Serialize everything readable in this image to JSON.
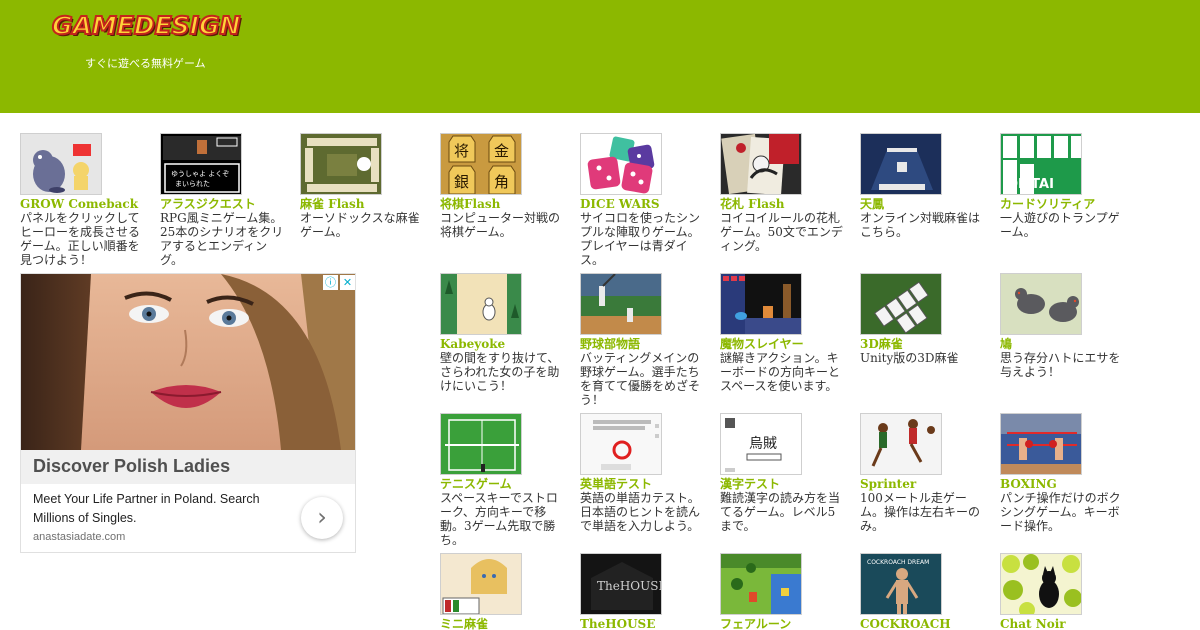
{
  "header": {
    "logo": "GAMEDESIGN",
    "tagline": "すぐに遊べる無料ゲーム",
    "bg_color": "#8cb800"
  },
  "games": [
    {
      "title": "GROW Comeback",
      "desc": "パネルをクリックしてヒーローを成長させるゲーム。正しい順番を見つけよう！",
      "thumb": "grow"
    },
    {
      "title": "アラスジクエスト",
      "desc": "RPG風ミニゲーム集。25本のシナリオをクリアするとエンディング。",
      "thumb": "rpg"
    },
    {
      "title": "麻雀 Flash",
      "desc": "オーソドックスな麻雀ゲーム。",
      "thumb": "mahjong"
    },
    {
      "title": "将棋Flash",
      "desc": "コンピューター対戦の将棋ゲーム。",
      "thumb": "shogi"
    },
    {
      "title": "DICE WARS",
      "desc": "サイコロを使ったシンプルな陣取りゲーム。プレイヤーは青ダイス。",
      "thumb": "dice"
    },
    {
      "title": "花札 Flash",
      "desc": "コイコイルールの花札ゲーム。50文でエンディング。",
      "thumb": "hanafuda"
    },
    {
      "title": "天鳳",
      "desc": "オンライン対戦麻雀はこちら。",
      "thumb": "tenhou"
    },
    {
      "title": "カードソリティア",
      "desc": "一人遊びのトランプゲーム。",
      "thumb": "solitaire"
    },
    {
      "title": "Kabeyoke",
      "desc": "壁の間をすり抜けて、さらわれた女の子を助けにいこう！",
      "thumb": "kabeyoke"
    },
    {
      "title": "野球部物語",
      "desc": "バッティングメインの野球ゲーム。選手たちを育てて優勝をめざそう！",
      "thumb": "baseball"
    },
    {
      "title": "魔物スレイヤー",
      "desc": "謎解きアクション。キーボードの方向キーとスペースを使います。",
      "thumb": "slayer"
    },
    {
      "title": "3D麻雀",
      "desc": "Unity版の3D麻雀",
      "thumb": "mahjong3d"
    },
    {
      "title": "鳩",
      "desc": "思う存分ハトにエサを与えよう！",
      "thumb": "pigeon"
    },
    {
      "title": "テニスゲーム",
      "desc": "スペースキーでストローク、方向キーで移動。3ゲーム先取で勝ち。",
      "thumb": "tennis"
    },
    {
      "title": "英単語テスト",
      "desc": "英語の単語カテスト。日本語のヒントを読んで単語を入力しよう。",
      "thumb": "eitango"
    },
    {
      "title": "漢字テスト",
      "desc": "難読漢字の読み方を当てるゲーム。レベル5まで。",
      "thumb": "kanji"
    },
    {
      "title": "Sprinter",
      "desc": "100メートル走ゲーム。操作は左右キーのみ。",
      "thumb": "sprinter"
    },
    {
      "title": "BOXING",
      "desc": "パンチ操作だけのボクシングゲーム。キーボード操作。",
      "thumb": "boxing"
    },
    {
      "title": "ミニ麻雀",
      "desc": "",
      "thumb": "minimahjong"
    },
    {
      "title": "TheHOUSE",
      "desc": "",
      "thumb": "house"
    },
    {
      "title": "フェアルーン",
      "desc": "",
      "thumb": "fairune"
    },
    {
      "title": "COCKROACH",
      "desc": "",
      "thumb": "cockroach"
    },
    {
      "title": "Chat Noir",
      "desc": "",
      "thumb": "chatnoir"
    }
  ],
  "thumb_text": {
    "rpg_line1": "ゆうしゃよ よくぞ",
    "rpg_line2": "まいられた",
    "house": "TheHOUSE",
    "kanji": "烏賊",
    "cockroach": "COCKROACH DREAM",
    "solitaire": "OLITAI"
  },
  "ad": {
    "headline": "Discover Polish Ladies",
    "body": "Meet Your Life Partner in Poland. Search Millions of Singles.",
    "url": "anastasiadate.com",
    "info_icon": "info-icon",
    "close_icon": "close-icon",
    "arrow": "›"
  }
}
